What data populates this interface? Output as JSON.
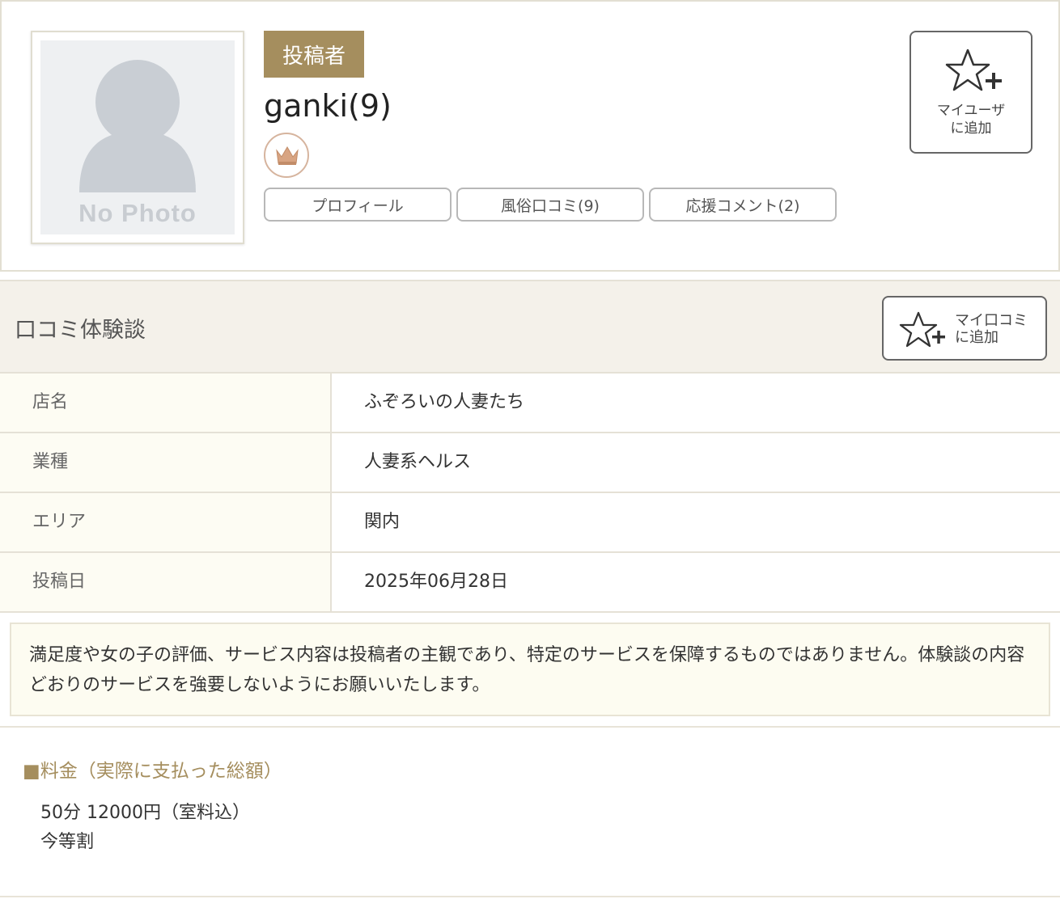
{
  "profile": {
    "avatar_placeholder": "No Photo",
    "role_badge": "投稿者",
    "username": "ganki(9)",
    "rank_icon": "crown-icon",
    "tabs": [
      {
        "label": "プロフィール"
      },
      {
        "label": "風俗口コミ(9)"
      },
      {
        "label": "応援コメント(2)"
      }
    ],
    "add_user_line1": "マイユーザ",
    "add_user_line2": "に追加"
  },
  "review": {
    "section_title": "口コミ体験談",
    "add_review_line1": "マイ口コミ",
    "add_review_line2": "に追加",
    "rows": [
      {
        "label": "店名",
        "value": "ふぞろいの人妻たち"
      },
      {
        "label": "業種",
        "value": "人妻系ヘルス"
      },
      {
        "label": "エリア",
        "value": "関内"
      },
      {
        "label": "投稿日",
        "value": "2025年06月28日"
      }
    ],
    "notice": "満足度や女の子の評価、サービス内容は投稿者の主観であり、特定のサービスを保障するものではありません。体験談の内容どおりのサービスを強要しないようにお願いいたします。",
    "price_heading": "■料金（実際に支払った総額）",
    "price_line1": "50分 12000円（室料込）",
    "price_line2": "今等割"
  },
  "colors": {
    "accent": "#a58e5e",
    "header_bg": "#f4f1ea",
    "label_bg": "#fdfcf3",
    "notice_bg": "#fdfcf1"
  }
}
